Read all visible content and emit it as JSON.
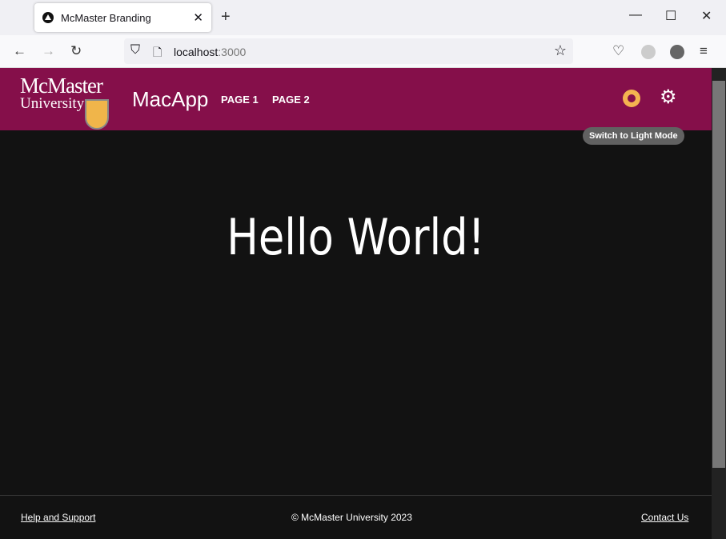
{
  "browser": {
    "tab_title": "McMaster Branding",
    "url_host": "localhost",
    "url_port": ":3000"
  },
  "header": {
    "logo_line1": "McMaster",
    "logo_line2": "University",
    "brand": "MacApp",
    "nav": [
      "PAGE 1",
      "PAGE 2"
    ],
    "tooltip": "Switch to Light Mode"
  },
  "main": {
    "heading": "Hello World!"
  },
  "footer": {
    "help": "Help and Support",
    "copyright": "© McMaster University 2023",
    "contact": "Contact Us"
  },
  "colors": {
    "header": "#850f4a",
    "background": "#121212",
    "sun": "#f4b350"
  }
}
